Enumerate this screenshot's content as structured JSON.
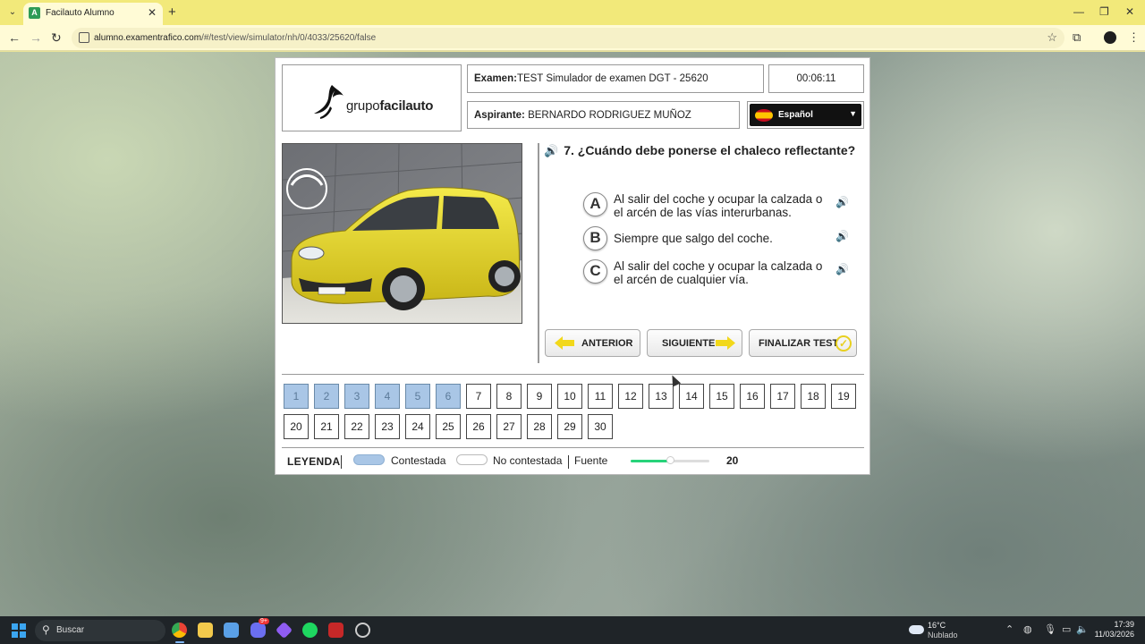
{
  "browser": {
    "tab_title": "Facilauto Alumno",
    "tab_favicon_letter": "A",
    "url_host": "alumno.examentrafico.com",
    "url_path": "/#/test/view/simulator/nh/0/4033/25620/false",
    "new_tab_glyph": "+",
    "close_glyph": "✕"
  },
  "header": {
    "logo_regular": "grupo",
    "logo_bold": "facilauto",
    "exam_label": "Examen:",
    "exam_value": "TEST Simulador de examen DGT - 25620",
    "timer": "00:06:11",
    "aspirant_label": "Aspirante:",
    "aspirant_value": "BERNARDO RODRIGUEZ MUÑOZ",
    "language": "Español"
  },
  "question": {
    "number": "7.",
    "text": "¿Cuándo debe ponerse el chaleco reflectante?",
    "answers": [
      {
        "letter": "A",
        "text": "Al salir del coche y ocupar la calzada o el arcén de las vías interurbanas."
      },
      {
        "letter": "B",
        "text": "Siempre que salgo del coche."
      },
      {
        "letter": "C",
        "text": "Al salir del coche y ocupar la calzada o el arcén de cualquier vía."
      }
    ]
  },
  "buttons": {
    "prev": "ANTERIOR",
    "next": "SIGUIENTE",
    "finish": "FINALIZAR TEST"
  },
  "grid": {
    "row1": [
      "1",
      "2",
      "3",
      "4",
      "5",
      "6",
      "7",
      "8",
      "9",
      "10",
      "11",
      "12",
      "13",
      "14",
      "15",
      "16",
      "17",
      "18",
      "19"
    ],
    "row2": [
      "20",
      "21",
      "22",
      "23",
      "24",
      "25",
      "26",
      "27",
      "28",
      "29",
      "30"
    ],
    "answered": [
      "1",
      "2",
      "3",
      "4",
      "5",
      "6"
    ]
  },
  "legend": {
    "title": "LEYENDA",
    "answered": "Contestada",
    "unanswered": "No contestada",
    "font_label": "Fuente",
    "font_value": "20",
    "font_slider_fraction": 0.5,
    "answered_color": "#a9c6e6",
    "slider_color": "#27d37a"
  },
  "taskbar": {
    "search": "Buscar",
    "badge": "9+",
    "temperature": "16°C",
    "weather": "Nublado",
    "time": "17:39",
    "date": "11/03/2026"
  }
}
